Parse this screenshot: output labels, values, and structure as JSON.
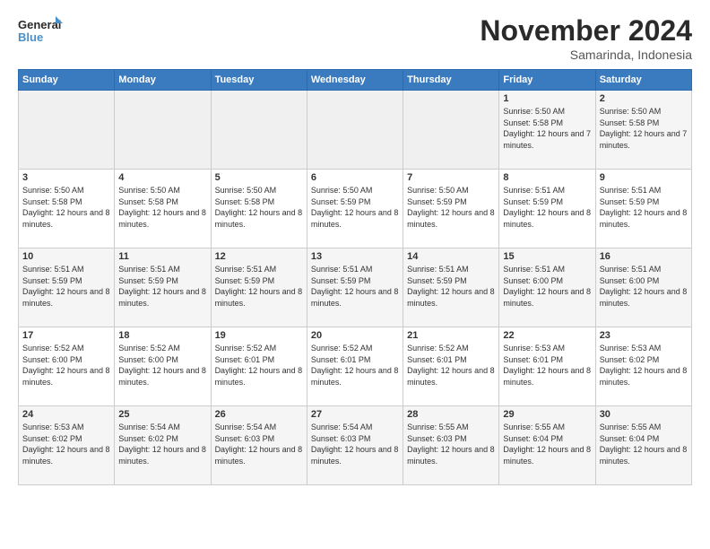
{
  "logo": {
    "line1": "General",
    "line2": "Blue"
  },
  "header": {
    "title": "November 2024",
    "subtitle": "Samarinda, Indonesia"
  },
  "days": [
    "Sunday",
    "Monday",
    "Tuesday",
    "Wednesday",
    "Thursday",
    "Friday",
    "Saturday"
  ],
  "weeks": [
    [
      {
        "day": "",
        "empty": true
      },
      {
        "day": "",
        "empty": true
      },
      {
        "day": "",
        "empty": true
      },
      {
        "day": "",
        "empty": true
      },
      {
        "day": "",
        "empty": true
      },
      {
        "day": "1",
        "sunrise": "Sunrise: 5:50 AM",
        "sunset": "Sunset: 5:58 PM",
        "daylight": "Daylight: 12 hours and 7 minutes."
      },
      {
        "day": "2",
        "sunrise": "Sunrise: 5:50 AM",
        "sunset": "Sunset: 5:58 PM",
        "daylight": "Daylight: 12 hours and 7 minutes."
      }
    ],
    [
      {
        "day": "3",
        "sunrise": "Sunrise: 5:50 AM",
        "sunset": "Sunset: 5:58 PM",
        "daylight": "Daylight: 12 hours and 8 minutes."
      },
      {
        "day": "4",
        "sunrise": "Sunrise: 5:50 AM",
        "sunset": "Sunset: 5:58 PM",
        "daylight": "Daylight: 12 hours and 8 minutes."
      },
      {
        "day": "5",
        "sunrise": "Sunrise: 5:50 AM",
        "sunset": "Sunset: 5:58 PM",
        "daylight": "Daylight: 12 hours and 8 minutes."
      },
      {
        "day": "6",
        "sunrise": "Sunrise: 5:50 AM",
        "sunset": "Sunset: 5:59 PM",
        "daylight": "Daylight: 12 hours and 8 minutes."
      },
      {
        "day": "7",
        "sunrise": "Sunrise: 5:50 AM",
        "sunset": "Sunset: 5:59 PM",
        "daylight": "Daylight: 12 hours and 8 minutes."
      },
      {
        "day": "8",
        "sunrise": "Sunrise: 5:51 AM",
        "sunset": "Sunset: 5:59 PM",
        "daylight": "Daylight: 12 hours and 8 minutes."
      },
      {
        "day": "9",
        "sunrise": "Sunrise: 5:51 AM",
        "sunset": "Sunset: 5:59 PM",
        "daylight": "Daylight: 12 hours and 8 minutes."
      }
    ],
    [
      {
        "day": "10",
        "sunrise": "Sunrise: 5:51 AM",
        "sunset": "Sunset: 5:59 PM",
        "daylight": "Daylight: 12 hours and 8 minutes."
      },
      {
        "day": "11",
        "sunrise": "Sunrise: 5:51 AM",
        "sunset": "Sunset: 5:59 PM",
        "daylight": "Daylight: 12 hours and 8 minutes."
      },
      {
        "day": "12",
        "sunrise": "Sunrise: 5:51 AM",
        "sunset": "Sunset: 5:59 PM",
        "daylight": "Daylight: 12 hours and 8 minutes."
      },
      {
        "day": "13",
        "sunrise": "Sunrise: 5:51 AM",
        "sunset": "Sunset: 5:59 PM",
        "daylight": "Daylight: 12 hours and 8 minutes."
      },
      {
        "day": "14",
        "sunrise": "Sunrise: 5:51 AM",
        "sunset": "Sunset: 5:59 PM",
        "daylight": "Daylight: 12 hours and 8 minutes."
      },
      {
        "day": "15",
        "sunrise": "Sunrise: 5:51 AM",
        "sunset": "Sunset: 6:00 PM",
        "daylight": "Daylight: 12 hours and 8 minutes."
      },
      {
        "day": "16",
        "sunrise": "Sunrise: 5:51 AM",
        "sunset": "Sunset: 6:00 PM",
        "daylight": "Daylight: 12 hours and 8 minutes."
      }
    ],
    [
      {
        "day": "17",
        "sunrise": "Sunrise: 5:52 AM",
        "sunset": "Sunset: 6:00 PM",
        "daylight": "Daylight: 12 hours and 8 minutes."
      },
      {
        "day": "18",
        "sunrise": "Sunrise: 5:52 AM",
        "sunset": "Sunset: 6:00 PM",
        "daylight": "Daylight: 12 hours and 8 minutes."
      },
      {
        "day": "19",
        "sunrise": "Sunrise: 5:52 AM",
        "sunset": "Sunset: 6:01 PM",
        "daylight": "Daylight: 12 hours and 8 minutes."
      },
      {
        "day": "20",
        "sunrise": "Sunrise: 5:52 AM",
        "sunset": "Sunset: 6:01 PM",
        "daylight": "Daylight: 12 hours and 8 minutes."
      },
      {
        "day": "21",
        "sunrise": "Sunrise: 5:52 AM",
        "sunset": "Sunset: 6:01 PM",
        "daylight": "Daylight: 12 hours and 8 minutes."
      },
      {
        "day": "22",
        "sunrise": "Sunrise: 5:53 AM",
        "sunset": "Sunset: 6:01 PM",
        "daylight": "Daylight: 12 hours and 8 minutes."
      },
      {
        "day": "23",
        "sunrise": "Sunrise: 5:53 AM",
        "sunset": "Sunset: 6:02 PM",
        "daylight": "Daylight: 12 hours and 8 minutes."
      }
    ],
    [
      {
        "day": "24",
        "sunrise": "Sunrise: 5:53 AM",
        "sunset": "Sunset: 6:02 PM",
        "daylight": "Daylight: 12 hours and 8 minutes."
      },
      {
        "day": "25",
        "sunrise": "Sunrise: 5:54 AM",
        "sunset": "Sunset: 6:02 PM",
        "daylight": "Daylight: 12 hours and 8 minutes."
      },
      {
        "day": "26",
        "sunrise": "Sunrise: 5:54 AM",
        "sunset": "Sunset: 6:03 PM",
        "daylight": "Daylight: 12 hours and 8 minutes."
      },
      {
        "day": "27",
        "sunrise": "Sunrise: 5:54 AM",
        "sunset": "Sunset: 6:03 PM",
        "daylight": "Daylight: 12 hours and 8 minutes."
      },
      {
        "day": "28",
        "sunrise": "Sunrise: 5:55 AM",
        "sunset": "Sunset: 6:03 PM",
        "daylight": "Daylight: 12 hours and 8 minutes."
      },
      {
        "day": "29",
        "sunrise": "Sunrise: 5:55 AM",
        "sunset": "Sunset: 6:04 PM",
        "daylight": "Daylight: 12 hours and 8 minutes."
      },
      {
        "day": "30",
        "sunrise": "Sunrise: 5:55 AM",
        "sunset": "Sunset: 6:04 PM",
        "daylight": "Daylight: 12 hours and 8 minutes."
      }
    ]
  ]
}
